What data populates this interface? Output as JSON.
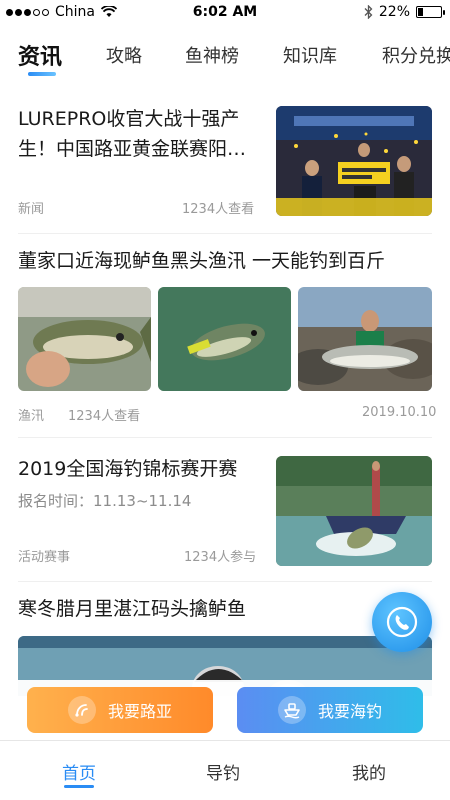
{
  "status_bar": {
    "carrier": "China",
    "time": "6:02 AM",
    "battery": "22%",
    "battery_level": 0.22
  },
  "tabs": [
    {
      "label": "资讯",
      "active": true
    },
    {
      "label": "攻略",
      "active": false
    },
    {
      "label": "鱼神榜",
      "active": false
    },
    {
      "label": "知识库",
      "active": false
    },
    {
      "label": "积分兑换",
      "active": false
    }
  ],
  "feed": [
    {
      "title": "LUREPRO收官大战十强产生！中国路亚黄金联赛阳…",
      "category": "新闻",
      "stat": "1234人查看"
    },
    {
      "title": "董家口近海现鲈鱼黑头渔汛 一天能钓到百斤",
      "category": "渔汛",
      "stat": "1234人查看",
      "date": "2019.10.10"
    },
    {
      "title": "2019全国海钓锦标赛开赛",
      "subtitle": "报名时间：11.13~11.14",
      "category": "活动赛事",
      "stat": "1234人参与"
    },
    {
      "title": "寒冬腊月里湛江码头擒鲈鱼"
    }
  ],
  "actions": {
    "lure_label": "我要路亚",
    "sea_label": "我要海钓"
  },
  "nav": [
    {
      "label": "首页",
      "active": true
    },
    {
      "label": "导钓",
      "active": false
    },
    {
      "label": "我的",
      "active": false
    }
  ],
  "colors": {
    "accent": "#2a8cf4",
    "lure_button": "#ff9a35",
    "sea_button": "#4aa3ee"
  },
  "icons": [
    "wifi-icon",
    "bluetooth-icon",
    "battery-icon",
    "phone-icon",
    "lure-icon",
    "boat-icon"
  ]
}
